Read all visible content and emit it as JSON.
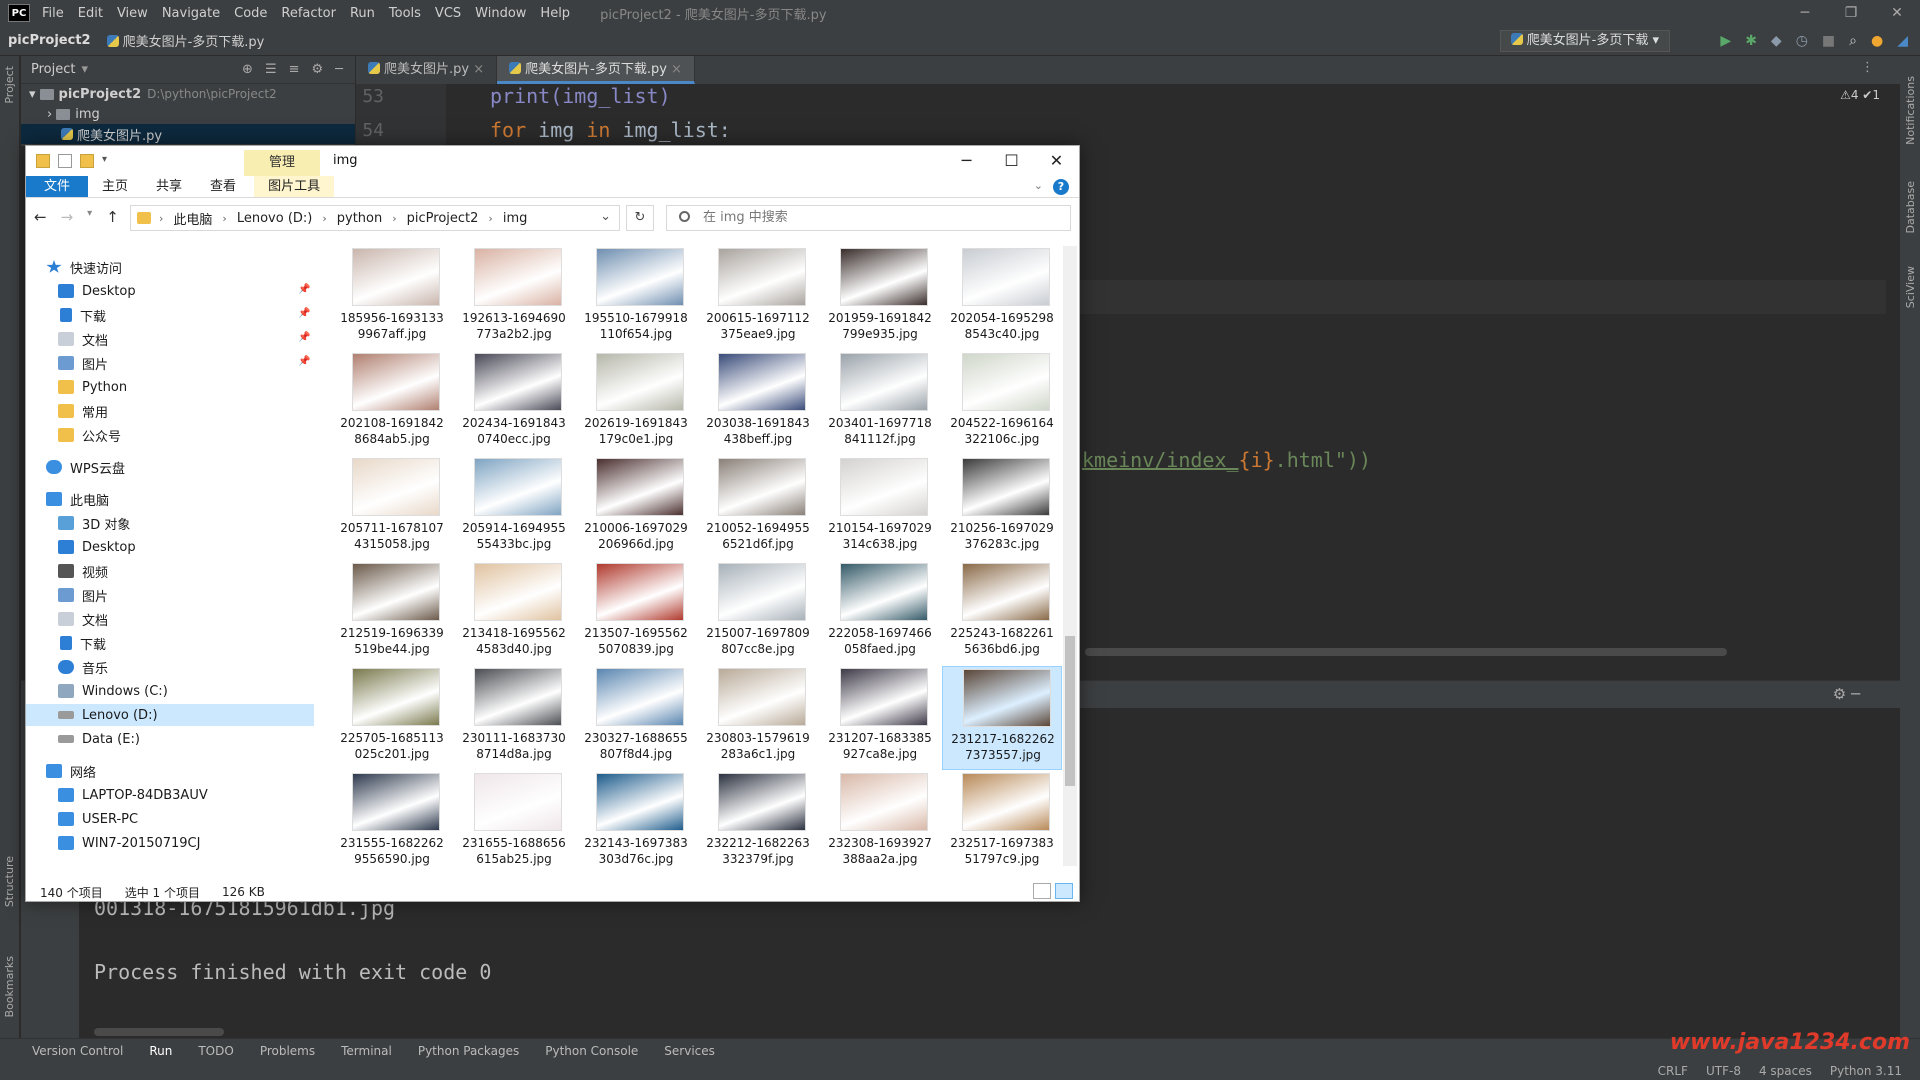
{
  "ide": {
    "logo": "PC",
    "menu": [
      "File",
      "Edit",
      "View",
      "Navigate",
      "Code",
      "Refactor",
      "Run",
      "Tools",
      "VCS",
      "Window",
      "Help"
    ],
    "window_title": "picProject2 - 爬美女图片-多页下载.py",
    "project_name": "picProject2",
    "current_file": "爬美女图片-多页下载.py",
    "run_config": "爬美女图片-多页下载",
    "project_panel": {
      "title": "Project",
      "root": "picProject2",
      "root_path": "D:\\python\\picProject2",
      "children": [
        "img",
        "爬美女图片.py"
      ]
    },
    "tabs": [
      "爬美女图片.py",
      "爬美女图片-多页下载.py"
    ],
    "lines": [
      {
        "num": "53",
        "code": "print(img_list)"
      },
      {
        "num": "54",
        "code_kw": "for",
        "code_var": " img ",
        "code_kw2": "in",
        "code_rest": " img_list:"
      }
    ],
    "code_fragment_url": "kmeinv/index_",
    "code_fragment_expr": "{i}",
    "code_fragment_tail": ".html\"))",
    "inspection": "⚠4 ✔1",
    "console": {
      "line1": "001318-16751815961db1.jpg",
      "line2": "Process finished with exit code 0"
    },
    "left_strip": [
      "Project",
      "Structure",
      "Bookmarks"
    ],
    "right_strip": [
      "Notifications",
      "Database",
      "SciView"
    ],
    "bottom_tools": [
      "Version Control",
      "Run",
      "TODO",
      "Problems",
      "Terminal",
      "Python Packages",
      "Python Console",
      "Services"
    ],
    "status": [
      "CRLF",
      "UTF-8",
      "4 spaces",
      "Python 3.11"
    ],
    "watermark": "www.java1234.com"
  },
  "explorer": {
    "title": "img",
    "manage_tab": "管理",
    "ribbon_tabs": [
      "文件",
      "主页",
      "共享",
      "查看",
      "图片工具"
    ],
    "breadcrumb": [
      "此电脑",
      "Lenovo (D:)",
      "python",
      "picProject2",
      "img"
    ],
    "search_placeholder": "在 img 中搜索",
    "nav": {
      "quick_access": "快速访问",
      "quick_items": [
        "Desktop",
        "下载",
        "文档",
        "图片",
        "Python",
        "常用",
        "公众号"
      ],
      "wps": "WPS云盘",
      "this_pc": "此电脑",
      "pc_items": [
        "3D 对象",
        "Desktop",
        "视频",
        "图片",
        "文档",
        "下载",
        "音乐",
        "Windows (C:)",
        "Lenovo (D:)",
        "Data (E:)"
      ],
      "network": "网络",
      "network_items": [
        "LAPTOP-84DB3AUV",
        "USER-PC",
        "WIN7-20150719CJ"
      ]
    },
    "files": [
      {
        "name": "185956-16931339967aff.jpg",
        "color": "#c9b6ad"
      },
      {
        "name": "192613-1694690773a2b2.jpg",
        "color": "#d9b2a3"
      },
      {
        "name": "195510-1679918110f654.jpg",
        "color": "#6f8fb0"
      },
      {
        "name": "200615-1697112375eae9.jpg",
        "color": "#a9a39d"
      },
      {
        "name": "201959-1691842799e935.jpg",
        "color": "#3a2e2c"
      },
      {
        "name": "202054-16952988543c40.jpg",
        "color": "#c8ccd2"
      },
      {
        "name": "202108-16918428684ab5.jpg",
        "color": "#b08070"
      },
      {
        "name": "202434-16918430740ecc.jpg",
        "color": "#4a4a58"
      },
      {
        "name": "202619-1691843179c0e1.jpg",
        "color": "#b6b7aa"
      },
      {
        "name": "203038-1691843438beff.jpg",
        "color": "#3a4c7a"
      },
      {
        "name": "203401-1697718841112f.jpg",
        "color": "#9aa3aa"
      },
      {
        "name": "204522-1696164322106c.jpg",
        "color": "#cfd6c9"
      },
      {
        "name": "205711-16781074315058.jpg",
        "color": "#e8d8c8"
      },
      {
        "name": "205914-169495555433bc.jpg",
        "color": "#7fa4c2"
      },
      {
        "name": "210006-1697029206966d.jpg",
        "color": "#4b2f2f"
      },
      {
        "name": "210052-16949556521d6f.jpg",
        "color": "#8a8078"
      },
      {
        "name": "210154-1697029314c638.jpg",
        "color": "#d4d2d0"
      },
      {
        "name": "210256-1697029376283c.jpg",
        "color": "#3b3b3b"
      },
      {
        "name": "212519-1696339519be44.jpg",
        "color": "#6b5a4a"
      },
      {
        "name": "213418-16955624583d40.jpg",
        "color": "#e0c2a0"
      },
      {
        "name": "213507-16955625070839.jpg",
        "color": "#b03a2e"
      },
      {
        "name": "215007-1697809807cc8e.jpg",
        "color": "#a7b1b9"
      },
      {
        "name": "222058-1697466058faed.jpg",
        "color": "#345a68"
      },
      {
        "name": "225243-16822615636bd6.jpg",
        "color": "#8a6a48"
      },
      {
        "name": "225705-1685113025c201.jpg",
        "color": "#7a7a4e"
      },
      {
        "name": "230111-16837308714d8a.jpg",
        "color": "#4a4d52"
      },
      {
        "name": "230327-1688655807f8d4.jpg",
        "color": "#5a86b0"
      },
      {
        "name": "230803-1579619283a6c1.jpg",
        "color": "#b8aa98"
      },
      {
        "name": "231207-1683385927ca8e.jpg",
        "color": "#3e3a48"
      },
      {
        "name": "231217-16822627373557.jpg",
        "color": "#5a4638",
        "selected": true
      },
      {
        "name": "231555-16822629556590.jpg",
        "color": "#2e3a4e"
      },
      {
        "name": "231655-1688656615ab25.jpg",
        "color": "#efe6ea"
      },
      {
        "name": "232143-1697383303d76c.jpg",
        "color": "#1e5c8c"
      },
      {
        "name": "232212-1682263332379f.jpg",
        "color": "#2c3240"
      },
      {
        "name": "232308-1693927388aa2a.jpg",
        "color": "#d8b8a8"
      },
      {
        "name": "232517-169738351797c9.jpg",
        "color": "#b88a58"
      }
    ],
    "status": {
      "count": "140 个项目",
      "selected": "选中 1 个项目",
      "size": "126 KB"
    }
  }
}
